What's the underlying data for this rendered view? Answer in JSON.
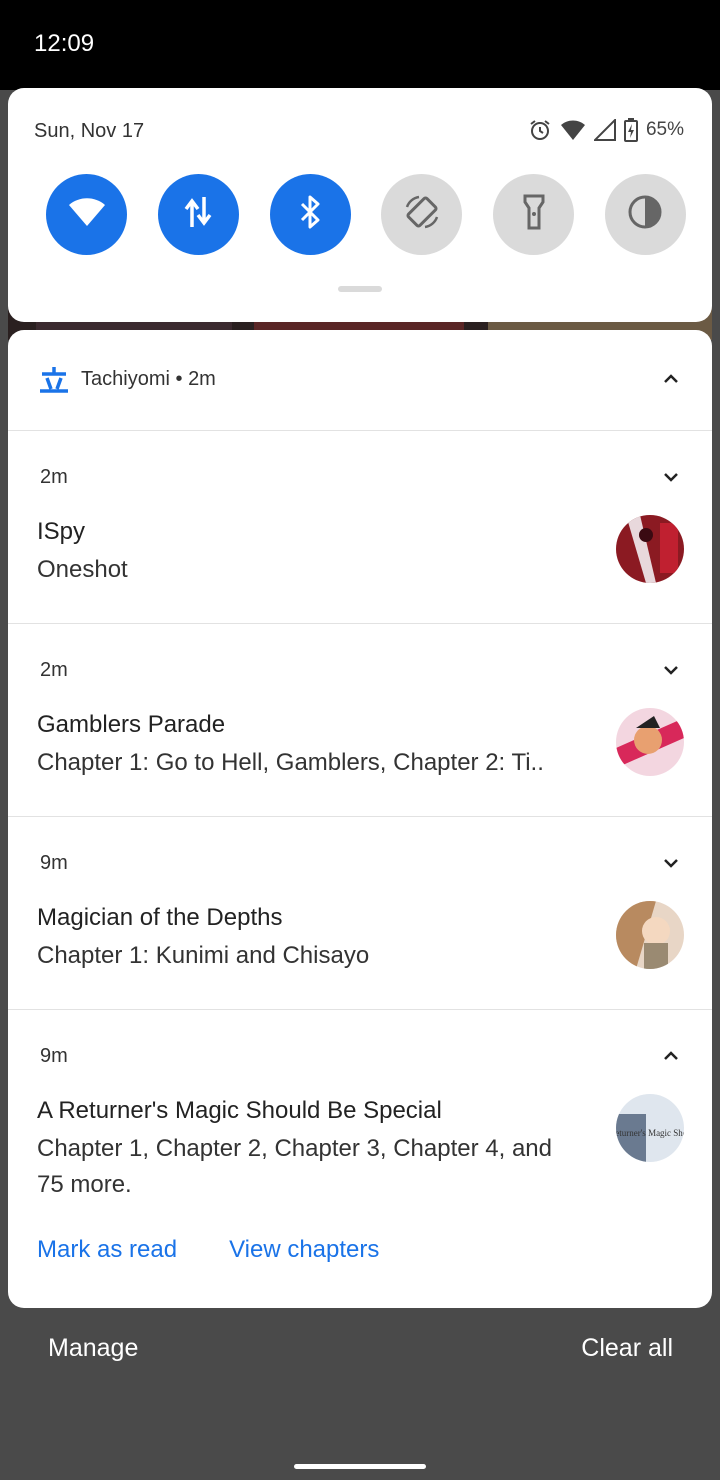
{
  "status_bar": {
    "time": "12:09"
  },
  "quick_settings": {
    "date": "Sun, Nov 17",
    "battery": "65%",
    "tiles": [
      {
        "icon": "wifi-icon",
        "state": "on"
      },
      {
        "icon": "mobile-data-icon",
        "state": "on"
      },
      {
        "icon": "bluetooth-icon",
        "state": "on"
      },
      {
        "icon": "auto-rotate-icon",
        "state": "off"
      },
      {
        "icon": "flashlight-icon",
        "state": "off"
      },
      {
        "icon": "invert-colors-icon",
        "state": "off"
      }
    ]
  },
  "notification_group": {
    "app_name": "Tachiyomi",
    "separator": "•",
    "age": "2m",
    "items": [
      {
        "age": "2m",
        "title": "ISpy",
        "body": "Oneshot"
      },
      {
        "age": "2m",
        "title": "Gamblers Parade",
        "body": "Chapter 1: Go to Hell, Gamblers, Chapter 2: Ti.."
      },
      {
        "age": "9m",
        "title": "Magician of the Depths",
        "body": "Chapter 1: Kunimi and Chisayo"
      },
      {
        "age": "9m",
        "title": "A Returner's Magic Should Be Special",
        "body": "Chapter 1, Chapter 2, Chapter 3, Chapter 4, and 75 more."
      }
    ],
    "actions": {
      "mark_read": "Mark as read",
      "view_chapters": "View chapters"
    },
    "thumb_text": "Returner's Magic Should"
  },
  "footer": {
    "manage": "Manage",
    "clear_all": "Clear all"
  },
  "colors": {
    "accent": "#1a73e8",
    "tile_off": "#dadada",
    "shade": "#4a4a4a"
  }
}
